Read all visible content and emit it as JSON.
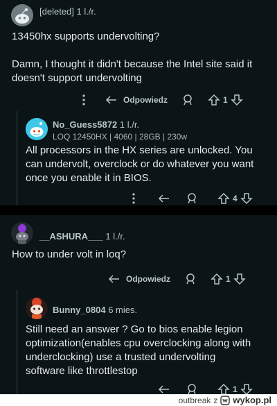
{
  "comments": [
    {
      "author": "[deleted]",
      "age": "1 l./r.",
      "lines": [
        "13450hx supports undervolting?",
        "",
        "Damn, I thought it didn't because the Intel site said it",
        "doesn't support undervolting"
      ],
      "reply_label": "Odpowiedz",
      "votes": "1"
    },
    {
      "author": "No_Guess5872",
      "age": "1 l./r.",
      "flair": "LOQ 12450HX | 4060 | 28GB | 230w",
      "lines": [
        "All processors in the HX series are unlocked. You",
        "can undervolt, overclock or do whatever you want",
        "once you enable it in BIOS."
      ],
      "votes": "4"
    },
    {
      "author": "__ASHURA___",
      "age": "1 l./r.",
      "lines": [
        "How to under volt in loq?"
      ],
      "reply_label": "Odpowiedz",
      "votes": "1"
    },
    {
      "author": "Bunny_0804",
      "age": "6 mies.",
      "lines": [
        "Still need an answer ? Go to bios enable legion",
        "optimization(enables cpu overclocking along with",
        "underclocking) use a trusted undervolting",
        "software like throttlestop"
      ],
      "votes": "1"
    }
  ],
  "footer": {
    "user": "outbreak",
    "via": "z",
    "site": "wykop.pl"
  },
  "colors": {
    "background": "#0b1416",
    "separator": "#000000",
    "accent_avatar": "#3fc7e8",
    "ashura_avatar": "#8a3bd4",
    "bunny_avatar": "#d9452b"
  },
  "icons": [
    "more-icon",
    "reply-icon",
    "award-icon",
    "upvote-icon",
    "downvote-icon",
    "snoo-avatar-icon"
  ]
}
